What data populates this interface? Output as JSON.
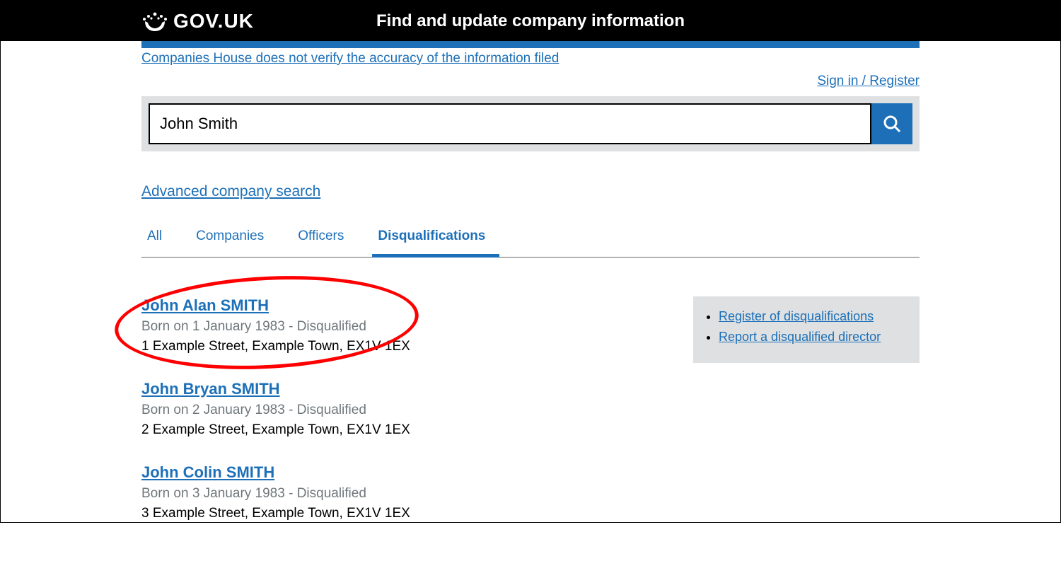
{
  "header": {
    "govuk": "GOV.UK",
    "service": "Find and update company information"
  },
  "verify_notice": "Companies House does not verify the accuracy of the information filed",
  "signin": "Sign in / Register",
  "search": {
    "value": "John Smith"
  },
  "advanced": "Advanced company search",
  "tabs": {
    "all": "All",
    "companies": "Companies",
    "officers": "Officers",
    "disqualifications": "Disqualifications"
  },
  "results": [
    {
      "name": "John Alan SMITH",
      "meta": "Born on 1 January 1983 - Disqualified",
      "addr": "1 Example Street, Example Town, EX1V 1EX"
    },
    {
      "name": "John Bryan SMITH",
      "meta": "Born on 2 January 1983 - Disqualified",
      "addr": "2 Example Street, Example Town, EX1V 1EX"
    },
    {
      "name": "John Colin SMITH",
      "meta": "Born on 3 January 1983 - Disqualified",
      "addr": "3 Example Street, Example Town, EX1V 1EX"
    }
  ],
  "sidebar": {
    "register": "Register of disqualifications",
    "report": "Report a disqualified director"
  }
}
